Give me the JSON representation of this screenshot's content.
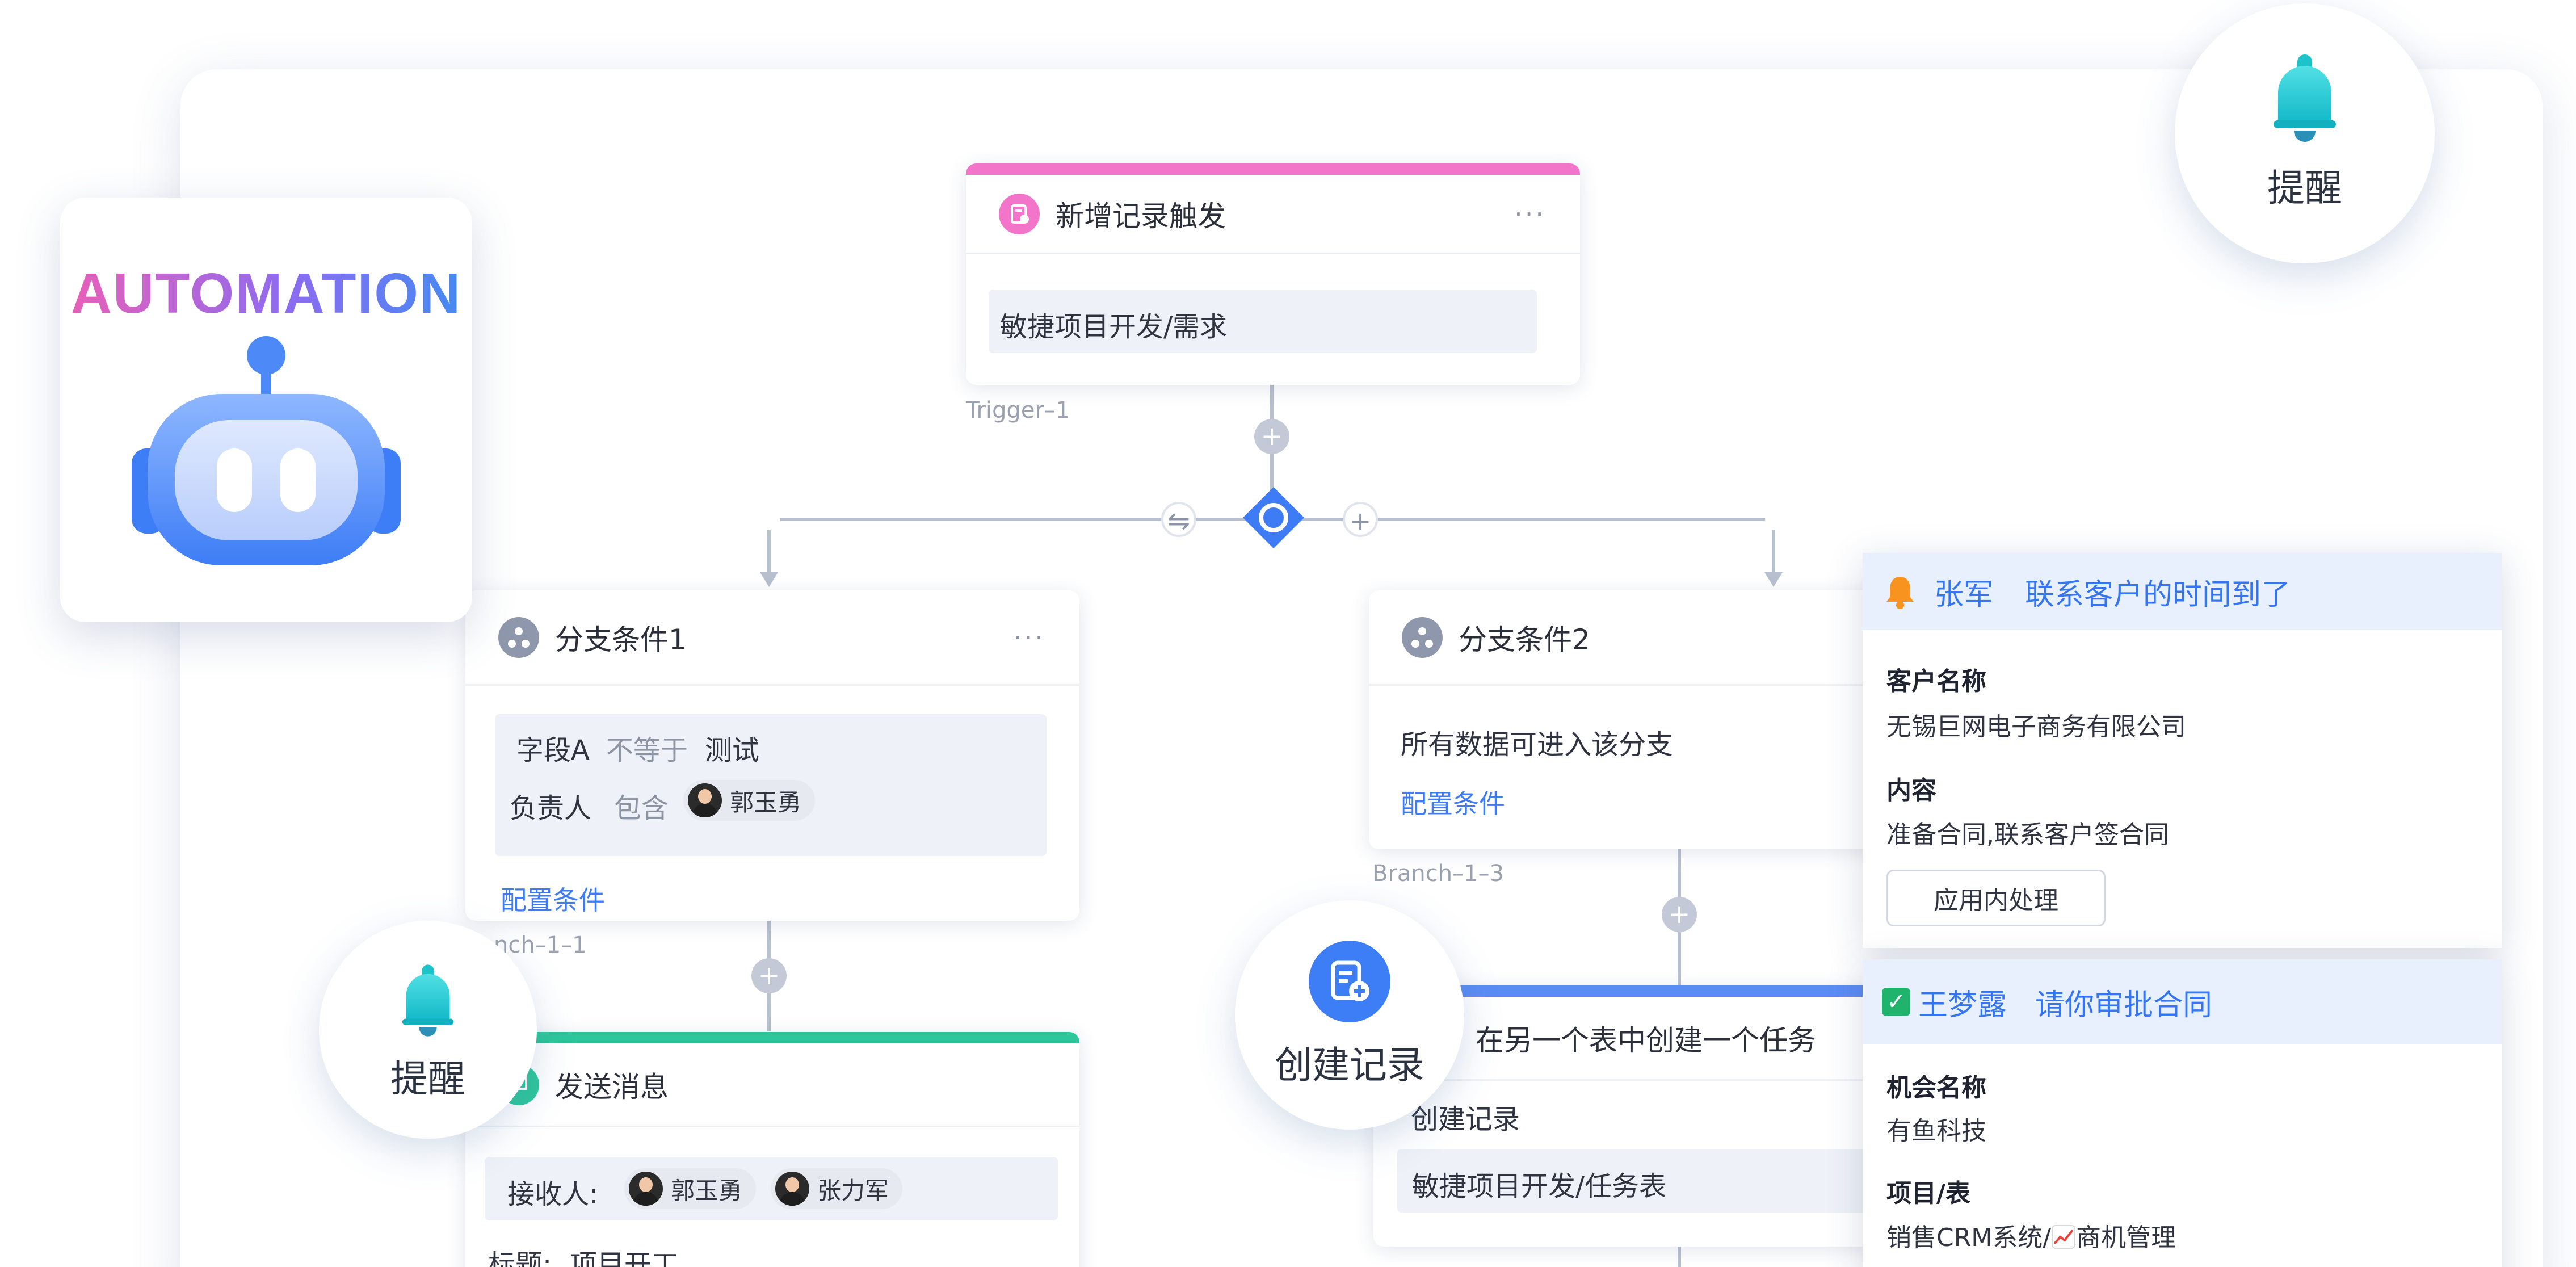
{
  "automation": {
    "title": "AUTOMATION"
  },
  "trigger": {
    "title": "新增记录触发",
    "more": "···",
    "content": "敏捷项目开发/需求",
    "tag": "Trigger–1"
  },
  "branch_controls": {
    "swap_icon": "⇋",
    "add": "+"
  },
  "branch1": {
    "title": "分支条件1",
    "more": "···",
    "row1": {
      "field": "字段A",
      "op": "不等于",
      "value": "测试"
    },
    "row2": {
      "field": "负责人",
      "op": "包含",
      "user": "郭玉勇"
    },
    "config_link": "配置条件",
    "tag": "nch–1–1"
  },
  "branch2": {
    "title": "分支条件2",
    "content": "所有数据可进入该分支",
    "config_link": "配置条件",
    "tag": "Branch–1–3"
  },
  "send_message": {
    "title": "发送消息",
    "recipients_label": "接收人:",
    "recipients": [
      "郭玉勇",
      "张力军"
    ],
    "subject_prefix": "标题:",
    "subject": "项目开工"
  },
  "create_task": {
    "title": "在另一个表中创建一个任务",
    "action": "创建记录",
    "target": "敏捷项目开发/任务表"
  },
  "bubbles": {
    "reminder_top": "提醒",
    "reminder_left": "提醒",
    "create_record": "创建记录"
  },
  "notification1": {
    "sender": "张军",
    "message": "联系客户的时间到了",
    "field1_label": "客户名称",
    "field1_value": "无锡巨网电子商务有限公司",
    "field2_label": "内容",
    "field2_value": "准备合同,联系客户签合同",
    "action_button": "应用内处理"
  },
  "notification2": {
    "check": "✓",
    "sender": "王梦露",
    "message": "请你审批合同",
    "field1_label": "机会名称",
    "field1_value": "有鱼科技",
    "field2_label": "项目/表",
    "field2_value_prefix": "销售CRM系统/",
    "field2_value_suffix": "商机管理"
  },
  "colors": {
    "trigger_accent": "#f275c9",
    "message_accent": "#2ec79b",
    "create_accent": "#5b8cf5",
    "link_blue": "#3f7cf4",
    "branch_icon": "#8e97ab",
    "bell_teal": "#1cc3c9"
  },
  "icons": {
    "trigger": "record-add-icon",
    "branch": "branch-icon",
    "message": "message-icon",
    "create": "create-record-icon",
    "bell": "bell-icon",
    "condition": "diamond-condition-icon",
    "chart_emoji": "chart-emoji-icon"
  }
}
